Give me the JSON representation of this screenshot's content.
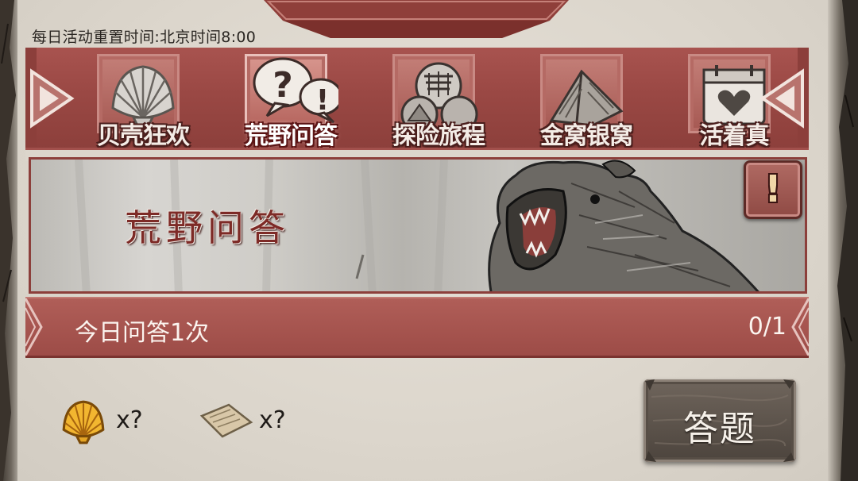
{
  "header": {
    "reset_notice": "每日活动重置时间:北京时间8:00"
  },
  "tabs": [
    {
      "label": "贝壳狂欢",
      "icon": "shell-icon",
      "active": false
    },
    {
      "label": "荒野问答",
      "icon": "question-bubbles-icon",
      "active": true
    },
    {
      "label": "探险旅程",
      "icon": "expedition-camp-icon",
      "active": false
    },
    {
      "label": "金窝银窝",
      "icon": "tent-icon",
      "active": false
    },
    {
      "label": "活着真",
      "icon": "calendar-heart-icon",
      "active": false
    }
  ],
  "banner": {
    "title": "荒野问答",
    "info_icon": "exclamation-icon"
  },
  "quota": {
    "label": "今日问答1次",
    "count": "0/1"
  },
  "rewards": [
    {
      "icon": "gold-shell-icon",
      "qty": "x?"
    },
    {
      "icon": "paper-note-icon",
      "qty": "x?"
    }
  ],
  "actions": {
    "answer_label": "答题"
  },
  "colors": {
    "accent_red": "#9a4844",
    "panel_bg": "#dcd6cc",
    "button_wood": "#5c534b"
  }
}
